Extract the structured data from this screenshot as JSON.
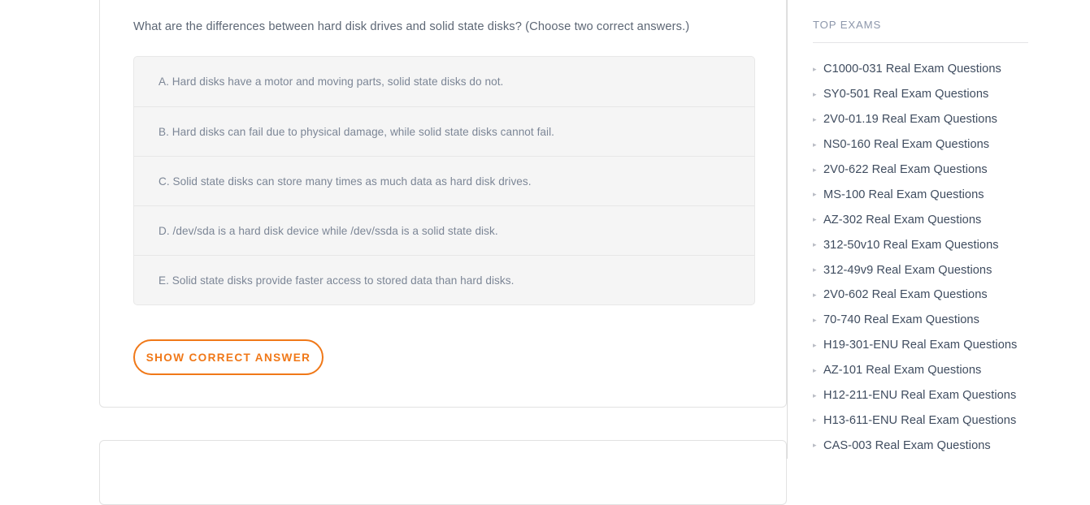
{
  "main": {
    "question": {
      "text": "What are the differences between hard disk drives and solid state disks? (Choose two correct answers.)",
      "options": [
        "A. Hard disks have a motor and moving parts, solid state disks do not.",
        "B. Hard disks can fail due to physical damage, while solid state disks cannot fail.",
        "C. Solid state disks can store many times as much data as hard disk drives.",
        "D. /dev/sda is a hard disk device while /dev/ssda is a solid state disk.",
        "E. Solid state disks provide faster access to stored data than hard disks."
      ],
      "show_answer_label": "SHOW CORRECT ANSWER"
    }
  },
  "sidebar": {
    "title": "TOP EXAMS",
    "bullet_glyph": "▸",
    "items": [
      {
        "label": "C1000-031 Real Exam Questions"
      },
      {
        "label": "SY0-501 Real Exam Questions"
      },
      {
        "label": "2V0-01.19 Real Exam Questions"
      },
      {
        "label": "NS0-160 Real Exam Questions"
      },
      {
        "label": "2V0-622 Real Exam Questions"
      },
      {
        "label": "MS-100 Real Exam Questions"
      },
      {
        "label": "AZ-302 Real Exam Questions"
      },
      {
        "label": "312-50v10 Real Exam Questions"
      },
      {
        "label": "312-49v9 Real Exam Questions"
      },
      {
        "label": "2V0-602 Real Exam Questions"
      },
      {
        "label": "70-740 Real Exam Questions"
      },
      {
        "label": "H19-301-ENU Real Exam Questions"
      },
      {
        "label": "AZ-101 Real Exam Questions"
      },
      {
        "label": "H12-211-ENU Real Exam Questions"
      },
      {
        "label": "H13-611-ENU Real Exam Questions"
      },
      {
        "label": "CAS-003 Real Exam Questions"
      }
    ]
  },
  "colors": {
    "accent_orange": "#f07818",
    "question_text": "#5d6775",
    "option_text": "#7c8696",
    "sidebar_link": "#3f4c5f",
    "sidebar_title": "#8d97ab",
    "card_border": "#e2e2e2",
    "option_bg": "#f5f5f5"
  }
}
